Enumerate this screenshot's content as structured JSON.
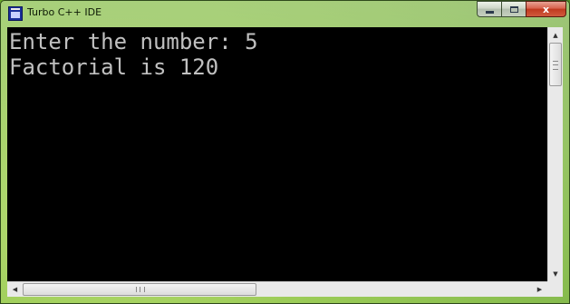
{
  "window": {
    "title": "Turbo C++ IDE",
    "icon": "turbo-cpp-app-icon"
  },
  "caption_buttons": {
    "minimize_icon": "minimize-icon",
    "maximize_icon": "maximize-icon",
    "close_icon": "close-icon",
    "close_glyph": "x"
  },
  "console": {
    "background": "#000000",
    "text_color": "#c0c0c0",
    "lines": [
      "Enter the number: 5",
      "Factorial is 120"
    ]
  },
  "scrollbars": {
    "up_arrow": "▲",
    "down_arrow": "▼",
    "left_arrow": "◀",
    "right_arrow": "▶"
  }
}
